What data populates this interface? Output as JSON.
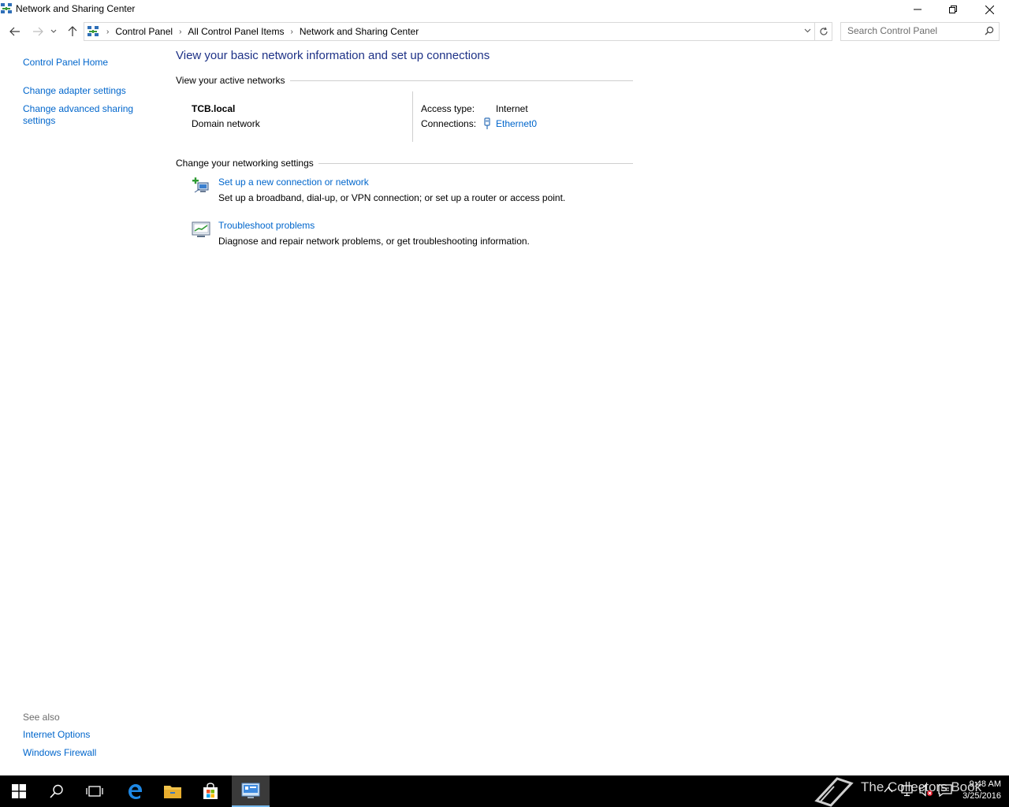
{
  "window": {
    "title": "Network and Sharing Center"
  },
  "address": {
    "crumbs": [
      "Control Panel",
      "All Control Panel Items",
      "Network and Sharing Center"
    ],
    "search_placeholder": "Search Control Panel"
  },
  "sidebar": {
    "home": "Control Panel Home",
    "items": [
      "Change adapter settings",
      "Change advanced sharing settings"
    ],
    "see_also_heading": "See also",
    "see_also": [
      "Internet Options",
      "Windows Firewall"
    ]
  },
  "main": {
    "title": "View your basic network information and set up connections",
    "active_networks_heading": "View your active networks",
    "network": {
      "name": "TCB.local",
      "type": "Domain network",
      "access_label": "Access type:",
      "access_value": "Internet",
      "connections_label": "Connections:",
      "connection_name": "Ethernet0"
    },
    "settings_heading": "Change your networking settings",
    "tasks": [
      {
        "link": "Set up a new connection or network",
        "desc": "Set up a broadband, dial-up, or VPN connection; or set up a router or access point."
      },
      {
        "link": "Troubleshoot problems",
        "desc": "Diagnose and repair network problems, or get troubleshooting information."
      }
    ]
  },
  "taskbar": {
    "time": "9:48 AM",
    "date": "3/25/2016",
    "watermark": "The Collectors Book"
  },
  "colors": {
    "link": "#0066cc",
    "title": "#1e3287",
    "taskbar": "#000000"
  }
}
